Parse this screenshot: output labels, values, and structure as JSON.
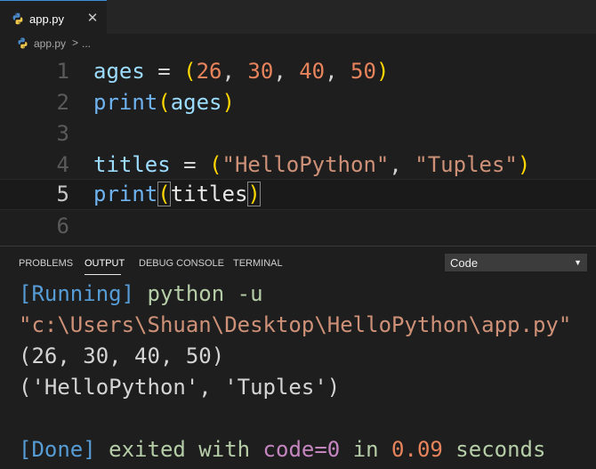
{
  "tab": {
    "label": "app.py",
    "close": "✕",
    "icon": "python-file-icon"
  },
  "breadcrumb": {
    "file": "app.py",
    "separator": ">",
    "more": "..."
  },
  "editor": {
    "line_numbers": [
      "1",
      "2",
      "3",
      "4",
      "5",
      "6"
    ],
    "current_line": "5",
    "lines": [
      [
        [
          "ages",
          "var"
        ],
        [
          " = ",
          "plain"
        ],
        [
          "(",
          "b1"
        ],
        [
          "26",
          "num"
        ],
        [
          ", ",
          "plain"
        ],
        [
          "30",
          "num"
        ],
        [
          ", ",
          "plain"
        ],
        [
          "40",
          "num"
        ],
        [
          ", ",
          "plain"
        ],
        [
          "50",
          "num"
        ],
        [
          ")",
          "b1"
        ]
      ],
      [
        [
          "print",
          "fn"
        ],
        [
          "(",
          "b1"
        ],
        [
          "ages",
          "var"
        ],
        [
          ")",
          "b1"
        ]
      ],
      [],
      [
        [
          "titles",
          "var"
        ],
        [
          " = ",
          "plain"
        ],
        [
          "(",
          "b1"
        ],
        [
          "\"HelloPython\"",
          "str"
        ],
        [
          ", ",
          "plain"
        ],
        [
          "\"Tuples\"",
          "str"
        ],
        [
          ")",
          "b1"
        ]
      ],
      [
        [
          "print",
          "fn"
        ],
        [
          "(",
          "b1m"
        ],
        [
          "titles",
          "v2"
        ],
        [
          ")",
          "b1m"
        ]
      ],
      []
    ]
  },
  "panel": {
    "tabs": [
      "PROBLEMS",
      "OUTPUT",
      "DEBUG CONSOLE",
      "TERMINAL"
    ],
    "active_tab": "OUTPUT",
    "channel_select": {
      "value": "Code",
      "arrow": "▼"
    },
    "output_lines": [
      [
        [
          "[Running]",
          "kw"
        ],
        [
          " python -u",
          "cmd"
        ]
      ],
      [
        [
          "\"c:\\Users\\Shuan\\Desktop\\HelloPython\\app.py\"",
          "str"
        ]
      ],
      [
        [
          "(26, 30, 40, 50)",
          "plain"
        ]
      ],
      [
        [
          "('HelloPython', 'Tuples')",
          "plain"
        ]
      ],
      [],
      [
        [
          "[Done]",
          "kw"
        ],
        [
          " exited with ",
          "green"
        ],
        [
          "code=0",
          "purple"
        ],
        [
          " in ",
          "green"
        ],
        [
          "0.09",
          "num"
        ],
        [
          " seconds",
          "green"
        ]
      ]
    ]
  },
  "colors": {
    "background": "#1e1e1e",
    "tabbar": "#252526",
    "keyword_blue": "#569cd6",
    "string_orange": "#ce9178",
    "number_orange": "#e8845c",
    "green_text": "#b5cea8",
    "purple_text": "#c586c0"
  }
}
